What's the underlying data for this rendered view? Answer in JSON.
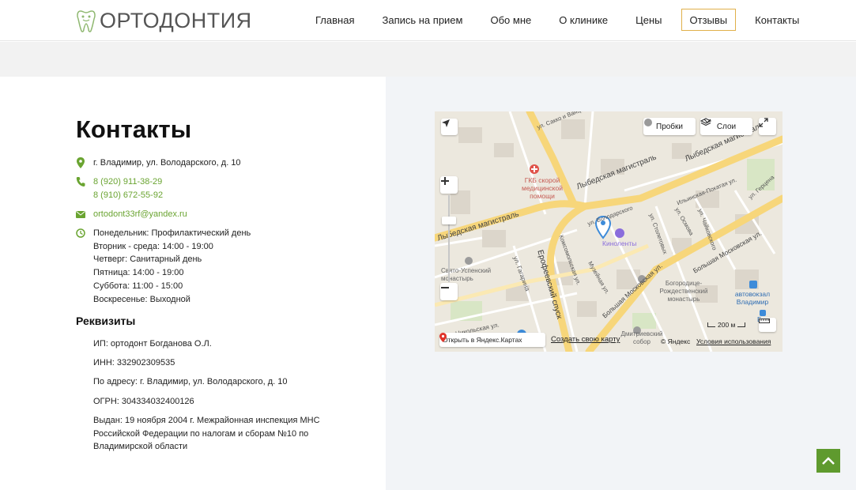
{
  "header": {
    "logo_text": "ОРТОДОНТИЯ",
    "nav": [
      {
        "label": "Главная"
      },
      {
        "label": "Запись на прием"
      },
      {
        "label": "Обо мне"
      },
      {
        "label": "О клинике"
      },
      {
        "label": "Цены"
      },
      {
        "label": "Отзывы",
        "active": true
      },
      {
        "label": "Контакты"
      }
    ]
  },
  "contacts": {
    "title": "Контакты",
    "address": "г. Владимир, ул. Володарского, д. 10",
    "phone1": "8 (920) 911-38-29",
    "phone2": "8 (910) 672-55-92",
    "email": "ortodont33rf@yandex.ru",
    "hours": [
      "Понедельник: Профилактический день",
      "Вторник - среда: 14:00 - 19:00",
      "Четверг: Санитарный день",
      "Пятница: 14:00 - 19:00",
      "Суббота: 11:00 - 15:00",
      "Воскресенье: Выходной"
    ]
  },
  "requisites": {
    "title": "Реквизиты",
    "ip": "ИП: ортодонт Богданова О.Л.",
    "inn": "ИНН: 332902309535",
    "address": "По адресу: г. Владимир, ул. Володарского, д. 10",
    "ogrn": "ОГРН: 304334032400126",
    "issued_line1": "Выдан: 19 ноября 2004 г. Межрайонная инспекция МНС",
    "issued_line2": "Российской Федерации по налогам и сборам №10 по",
    "issued_line3": "Владимирской области"
  },
  "map": {
    "traffic_label": "Пробки",
    "layers_label": "Слои",
    "open_label": "Открыть в Яндекс.Картах",
    "create_label": "Создать свою карту",
    "copyright": "© Яндекс",
    "terms": "Условия использования",
    "scale": "200 м",
    "labels": {
      "hospital": "ГКБ скорой медицинской помощи",
      "street_lybed1": "Лыбедская магистраль",
      "street_lybed2": "Лыбедская магистраль",
      "street_lybed3": "Лыбедская магистраль",
      "cinema": "Киноленты",
      "monastery1": "Свято-Успенский монастырь",
      "monastery2": "Богородице-Рождественский монастырь",
      "bus": "автовокзал Владимир",
      "erofeev": "Ерофеевский спуск",
      "gagarina": "ул. Гагарина",
      "bolshaya_mosk": "Большая Московская ул.",
      "bolshaya_mosk2": "Большая Московская ул.",
      "komsomol": "Комсомольская ул.",
      "nikolsk": "2-я Никольская ул.",
      "musei": "Музейная ул.",
      "sacco": "ул. Сакко и Ванцетти",
      "ilinsk": "Ильинская-Покатая ул.",
      "gerzen": "ул. Герцена",
      "chaik": "ул. Чайковского",
      "stoletova": "ул. Столетовых",
      "osmova": "ул. Осмова",
      "volod": "ул. Володарского",
      "dmitr": "Дмитриевский собор",
      "vlad_station": "Вла"
    }
  },
  "colors": {
    "accent_green": "#6aa431",
    "active_border": "#e0b04a",
    "to_top_bg": "#5f9a2e"
  }
}
